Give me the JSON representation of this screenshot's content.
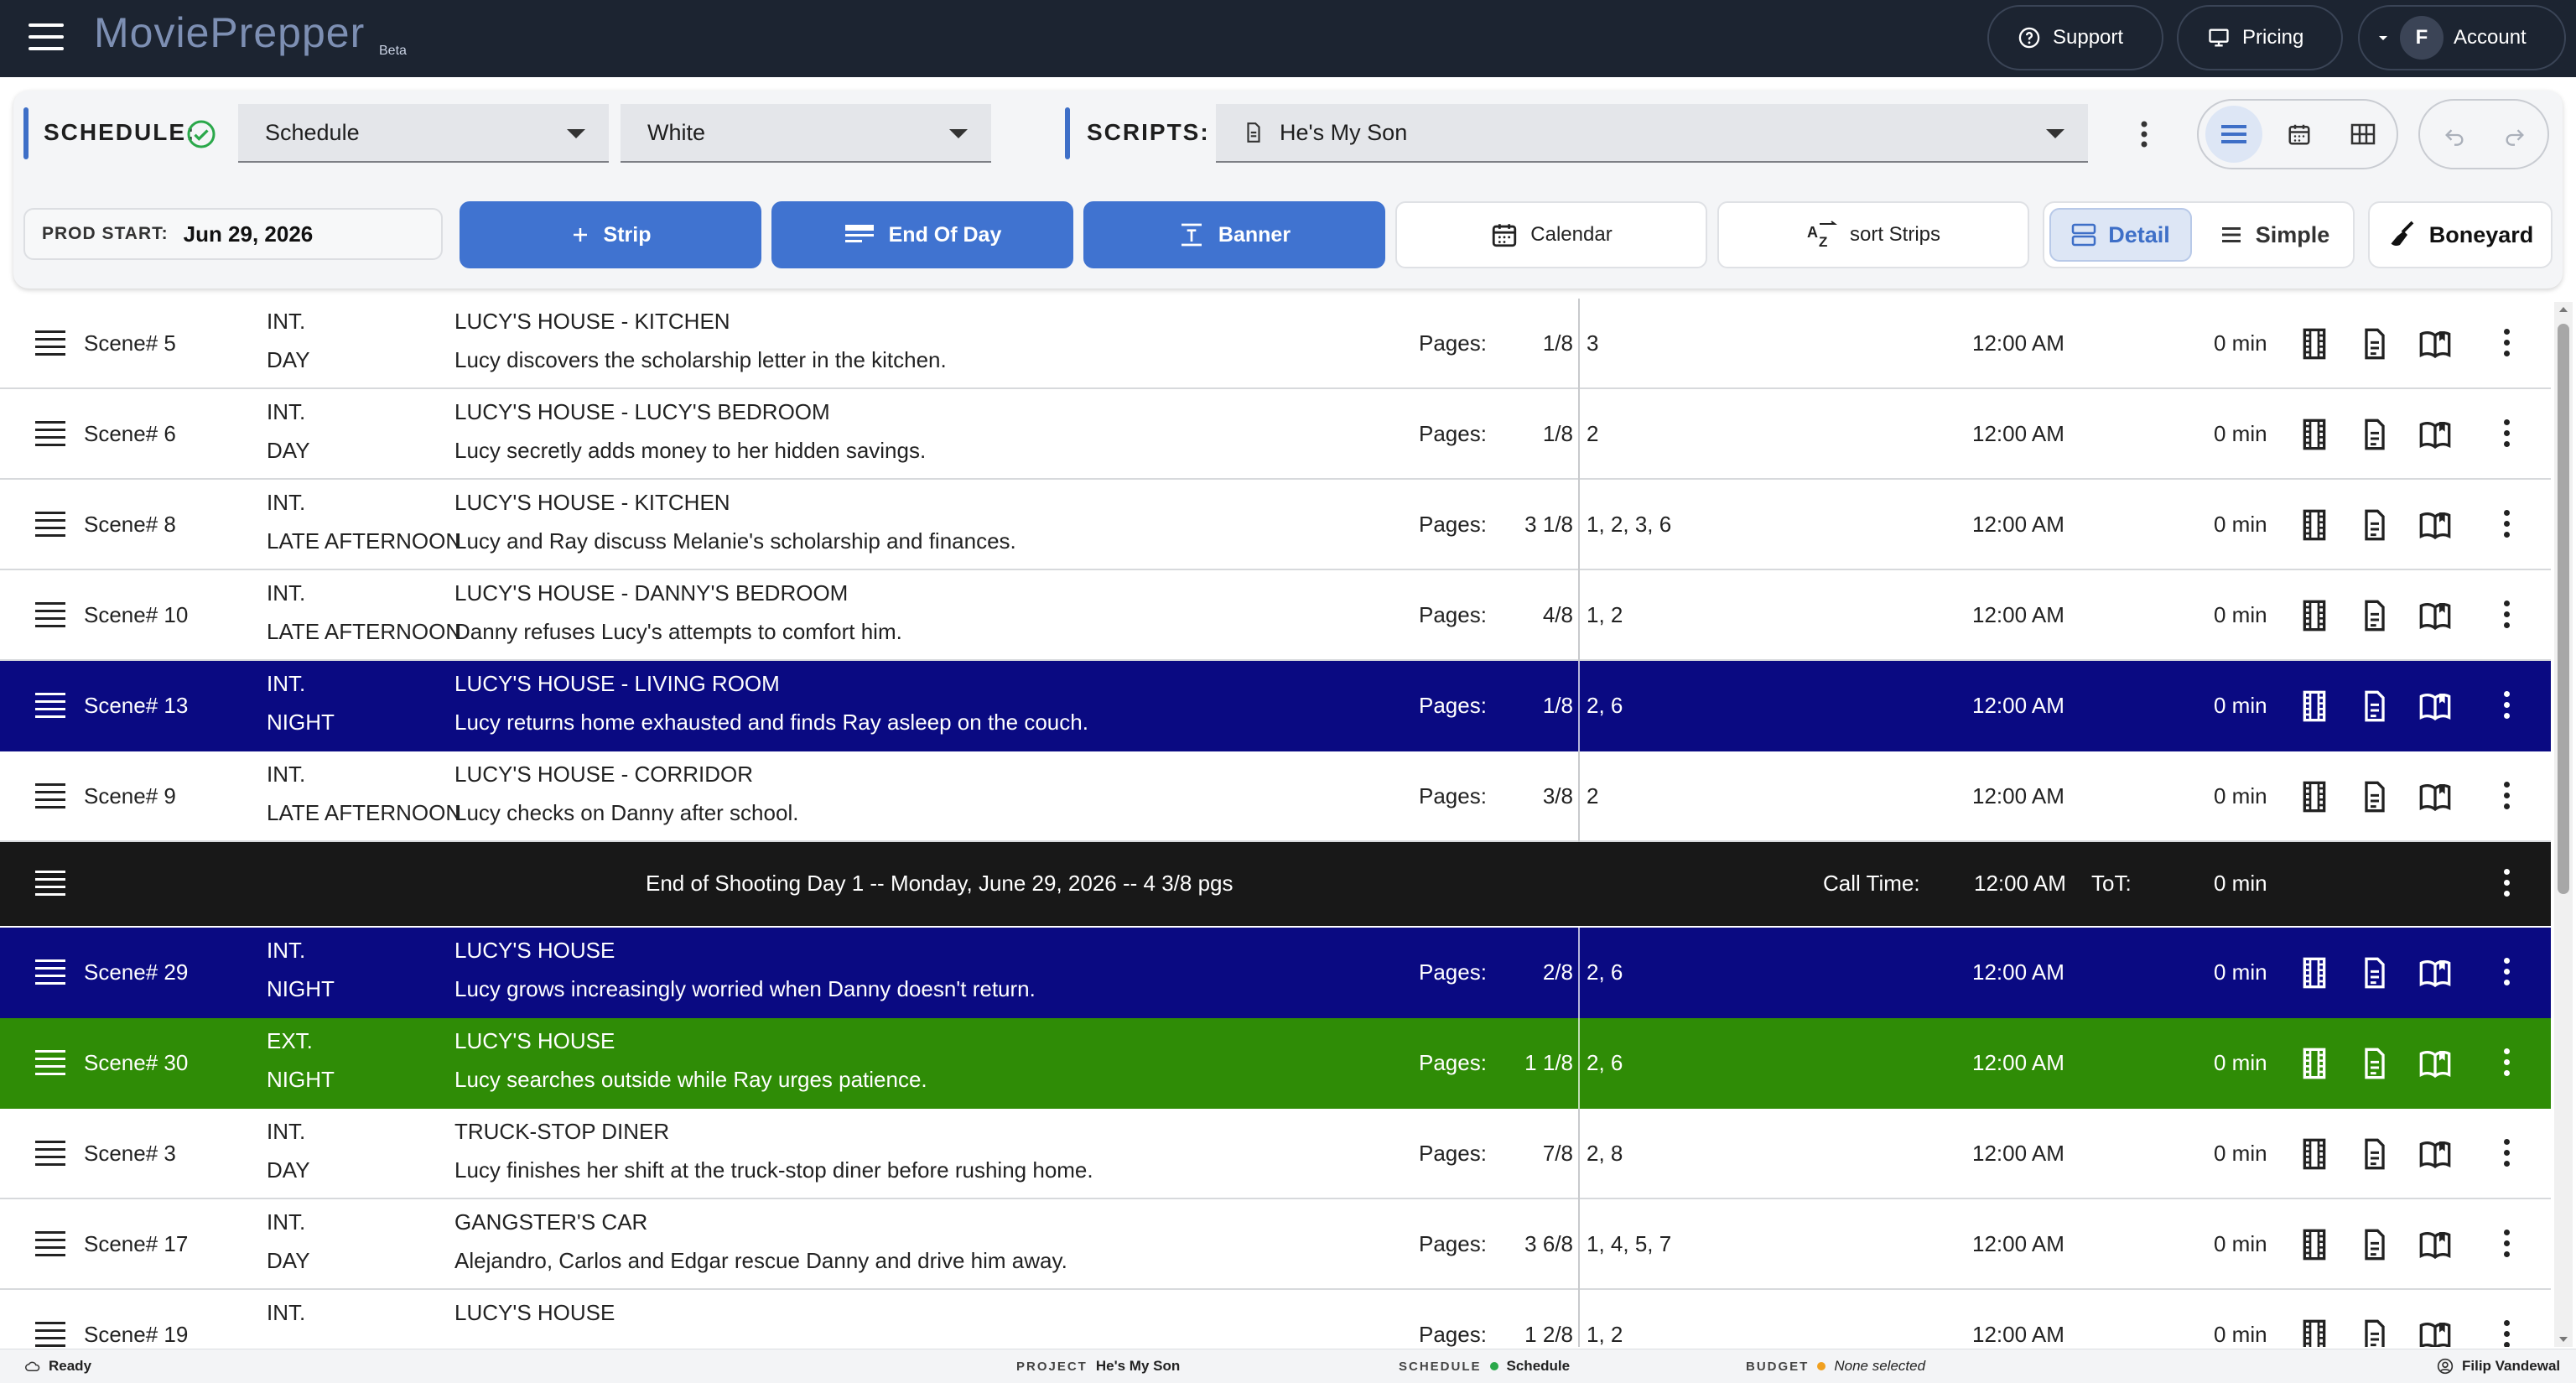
{
  "app": {
    "name": "MoviePrepper",
    "badge": "Beta"
  },
  "topnav": {
    "support": "Support",
    "pricing": "Pricing",
    "account": "Account",
    "account_initial": "F"
  },
  "toolbar": {
    "schedule_label": "SCHEDULE:",
    "schedule_select": "Schedule",
    "color_select": "White",
    "scripts_label": "SCRIPTS:",
    "script_select": "He's My Son",
    "prod_start_label": "PROD START:",
    "prod_start_value": "Jun 29, 2026",
    "strip_btn": "Strip",
    "end_of_day_btn": "End Of Day",
    "banner_btn": "Banner",
    "calendar_btn": "Calendar",
    "sort_btn": "sort Strips",
    "detail_btn": "Detail",
    "simple_btn": "Simple",
    "boneyard_btn": "Boneyard"
  },
  "strips": [
    {
      "scene": "Scene# 5",
      "ie": "INT.",
      "tod": "DAY",
      "location": "LUCY'S HOUSE - KITCHEN",
      "description": "Lucy discovers the scholarship letter in the kitchen.",
      "pages_label": "Pages:",
      "pages": "1/8",
      "cast": "3",
      "time": "12:00 AM",
      "duration": "0 min",
      "color": "white"
    },
    {
      "scene": "Scene# 6",
      "ie": "INT.",
      "tod": "DAY",
      "location": "LUCY'S HOUSE - LUCY'S BEDROOM",
      "description": "Lucy secretly adds money to her hidden savings.",
      "pages_label": "Pages:",
      "pages": "1/8",
      "cast": "2",
      "time": "12:00 AM",
      "duration": "0 min",
      "color": "white"
    },
    {
      "scene": "Scene# 8",
      "ie": "INT.",
      "tod": "LATE AFTERNOON",
      "location": "LUCY'S HOUSE - KITCHEN",
      "description": "Lucy and Ray discuss Melanie's scholarship and finances.",
      "pages_label": "Pages:",
      "pages": "3 1/8",
      "cast": "1, 2, 3, 6",
      "time": "12:00 AM",
      "duration": "0 min",
      "color": "white"
    },
    {
      "scene": "Scene# 10",
      "ie": "INT.",
      "tod": "LATE AFTERNOON",
      "location": "LUCY'S HOUSE - DANNY'S BEDROOM",
      "description": "Danny refuses Lucy's attempts to comfort him.",
      "pages_label": "Pages:",
      "pages": "4/8",
      "cast": "1, 2",
      "time": "12:00 AM",
      "duration": "0 min",
      "color": "white"
    },
    {
      "scene": "Scene# 13",
      "ie": "INT.",
      "tod": "NIGHT",
      "location": "LUCY'S HOUSE - LIVING ROOM",
      "description": "Lucy returns home exhausted and finds Ray asleep on the couch.",
      "pages_label": "Pages:",
      "pages": "1/8",
      "cast": "2, 6",
      "time": "12:00 AM",
      "duration": "0 min",
      "color": "navy"
    },
    {
      "scene": "Scene# 9",
      "ie": "INT.",
      "tod": "LATE AFTERNOON",
      "location": "LUCY'S HOUSE - CORRIDOR",
      "description": "Lucy checks on Danny after school.",
      "pages_label": "Pages:",
      "pages": "3/8",
      "cast": "2",
      "time": "12:00 AM",
      "duration": "0 min",
      "color": "white"
    }
  ],
  "end_of_day": {
    "text": "End of Shooting Day 1 -- Monday, June 29, 2026 -- 4 3/8 pgs",
    "call_label": "Call Time:",
    "call_value": "12:00 AM",
    "tot_label": "ToT:",
    "tot_value": "0 min"
  },
  "strips2": [
    {
      "scene": "Scene# 29",
      "ie": "INT.",
      "tod": "NIGHT",
      "location": "LUCY'S HOUSE",
      "description": "Lucy grows increasingly worried when Danny doesn't return.",
      "pages_label": "Pages:",
      "pages": "2/8",
      "cast": "2, 6",
      "time": "12:00 AM",
      "duration": "0 min",
      "color": "navy"
    },
    {
      "scene": "Scene# 30",
      "ie": "EXT.",
      "tod": "NIGHT",
      "location": "LUCY'S HOUSE",
      "description": "Lucy searches outside while Ray urges patience.",
      "pages_label": "Pages:",
      "pages": "1 1/8",
      "cast": "2, 6",
      "time": "12:00 AM",
      "duration": "0 min",
      "color": "green"
    },
    {
      "scene": "Scene# 3",
      "ie": "INT.",
      "tod": "DAY",
      "location": "TRUCK-STOP DINER",
      "description": "Lucy finishes her shift at the truck-stop diner before rushing home.",
      "pages_label": "Pages:",
      "pages": "7/8",
      "cast": "2, 8",
      "time": "12:00 AM",
      "duration": "0 min",
      "color": "white"
    },
    {
      "scene": "Scene# 17",
      "ie": "INT.",
      "tod": "DAY",
      "location": "GANGSTER'S CAR",
      "description": "Alejandro, Carlos and Edgar rescue Danny and drive him away.",
      "pages_label": "Pages:",
      "pages": "3 6/8",
      "cast": "1, 4, 5, 7",
      "time": "12:00 AM",
      "duration": "0 min",
      "color": "white"
    },
    {
      "scene": "Scene# 19",
      "ie": "INT.",
      "tod": "",
      "location": "LUCY'S HOUSE",
      "description": "",
      "pages_label": "Pages:",
      "pages": "1 2/8",
      "cast": "1, 2",
      "time": "12:00 AM",
      "duration": "0 min",
      "color": "white"
    }
  ],
  "statusbar": {
    "ready": "Ready",
    "project_label": "PROJECT",
    "project_value": "He's My Son",
    "schedule_label": "SCHEDULE",
    "schedule_value": "Schedule",
    "budget_label": "BUDGET",
    "budget_value": "None selected",
    "user": "Filip Vandewal"
  },
  "colors": {
    "navy_strip": "#0a0a82",
    "green_strip": "#2f8c06",
    "accent": "#4073d0",
    "topbar": "#1c2431"
  }
}
